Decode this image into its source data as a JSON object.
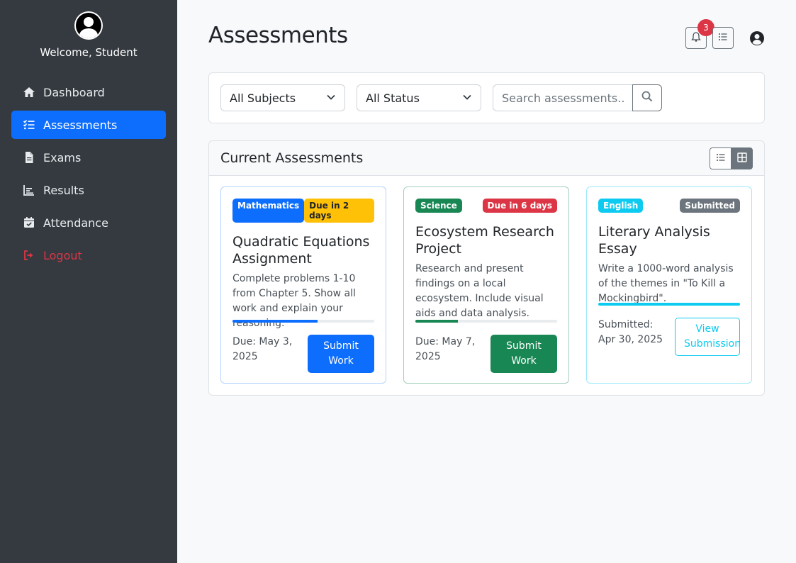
{
  "sidebar": {
    "welcome": "Welcome, Student",
    "items": [
      {
        "label": "Dashboard",
        "icon": "home-icon"
      },
      {
        "label": "Assessments",
        "icon": "tasks-icon",
        "active": true
      },
      {
        "label": "Exams",
        "icon": "file-icon"
      },
      {
        "label": "Results",
        "icon": "chart-icon"
      },
      {
        "label": "Attendance",
        "icon": "calendar-check-icon"
      },
      {
        "label": "Logout",
        "icon": "sign-out-icon"
      }
    ]
  },
  "header": {
    "title": "Assessments",
    "notification_count": "3"
  },
  "filters": {
    "subject": "All Subjects",
    "status": "All Status",
    "search_placeholder": "Search assessments..."
  },
  "list": {
    "title": "Current Assessments",
    "cards": [
      {
        "subject": "Mathematics",
        "status": "Due in 2 days",
        "title": "Quadratic Equations Assignment",
        "description": "Complete problems 1-10 from Chapter 5. Show all work and explain your reasoning.",
        "progress": 0.6,
        "due": "Due: May 3, 2025",
        "action": "Submit Work"
      },
      {
        "subject": "Science",
        "status": "Due in 6 days",
        "title": "Ecosystem Research Project",
        "description": "Research and present findings on a local ecosystem. Include visual aids and data analysis.",
        "progress": 0.3,
        "due": "Due: May 7, 2025",
        "action": "Submit Work"
      },
      {
        "subject": "English",
        "status": "Submitted",
        "title": "Literary Analysis Essay",
        "description": "Write a 1000-word analysis of the themes in \"To Kill a Mockingbird\".",
        "progress": 1.0,
        "due": "Submitted: Apr 30, 2025",
        "action": "View Submission"
      }
    ]
  },
  "colors": {
    "primary": "#0d6efd",
    "warning": "#ffc107",
    "success": "#198754",
    "danger": "#dc3545",
    "info": "#0dcaf0",
    "secondary": "#6c757d",
    "sidebar_bg": "#343a40"
  }
}
